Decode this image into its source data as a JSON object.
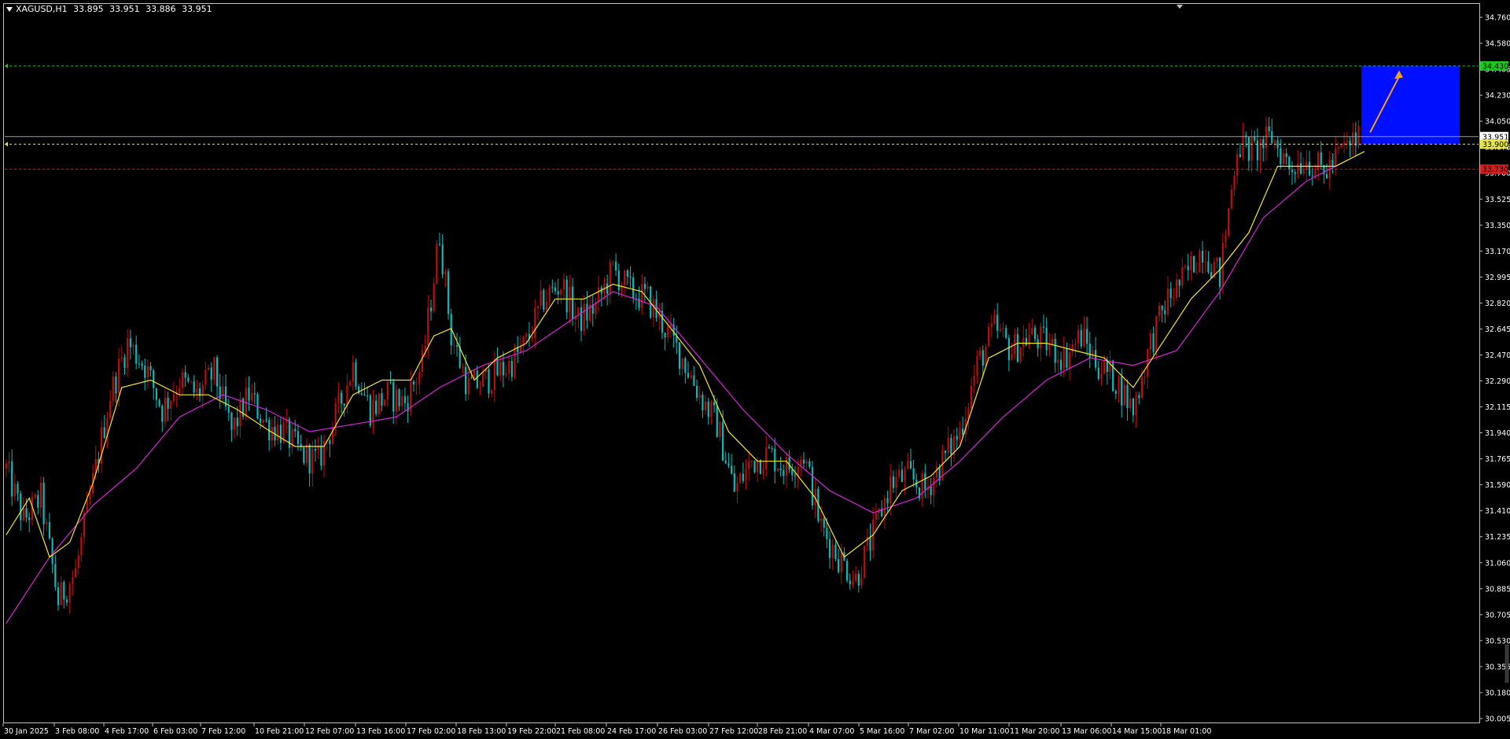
{
  "header": {
    "symbol": "XAGUSD,H1",
    "open": "33.895",
    "high": "33.951",
    "low": "33.886",
    "close": "33.951"
  },
  "colors": {
    "background": "#000000",
    "frame": "#C0C0C0",
    "bull_candle": "#B80F0F",
    "bear_candle": "#0FB8B8",
    "ma_fast": "#F2E626",
    "ma_slow": "#D626D6",
    "target_line": "#1EC81E",
    "entry_line": "#E6E646",
    "stop_line": "#D21E1E",
    "target_box": "#0010FF",
    "arrow": "#F0A020",
    "axis_text": "#FFFFFF"
  },
  "chart_data": {
    "type": "candlestick",
    "x_tick_labels": [
      "30 Jan 2025",
      "3 Feb 08:00",
      "4 Feb 17:00",
      "6 Feb 03:00",
      "7 Feb 12:00",
      "10 Feb 21:00",
      "12 Feb 07:00",
      "13 Feb 16:00",
      "17 Feb 02:00",
      "18 Feb 13:00",
      "19 Feb 22:00",
      "21 Feb 08:00",
      "24 Feb 17:00",
      "26 Feb 03:00",
      "27 Feb 12:00",
      "28 Feb 21:00",
      "4 Mar 07:00",
      "5 Mar 16:00",
      "7 Mar 02:00",
      "10 Mar 11:00",
      "11 Mar 20:00",
      "13 Mar 06:00",
      "14 Mar 15:00",
      "18 Mar 01:00"
    ],
    "y_tick_labels": [
      "34.760",
      "34.580",
      "34.405",
      "34.230",
      "34.050",
      "33.875",
      "33.700",
      "33.525",
      "33.350",
      "33.170",
      "32.995",
      "32.820",
      "32.645",
      "32.470",
      "32.290",
      "32.115",
      "31.940",
      "31.765",
      "31.590",
      "31.410",
      "31.235",
      "31.060",
      "30.885",
      "30.705",
      "30.530",
      "30.355",
      "30.180",
      "30.005"
    ],
    "y_range": [
      30.005,
      34.76
    ],
    "close_path": [
      [
        0,
        31.7
      ],
      [
        6,
        31.35
      ],
      [
        12,
        31.5
      ],
      [
        18,
        30.8
      ],
      [
        24,
        31.0
      ],
      [
        30,
        31.6
      ],
      [
        36,
        32.2
      ],
      [
        42,
        32.55
      ],
      [
        48,
        32.4
      ],
      [
        54,
        32.1
      ],
      [
        60,
        32.3
      ],
      [
        66,
        32.2
      ],
      [
        72,
        32.35
      ],
      [
        78,
        31.95
      ],
      [
        84,
        32.2
      ],
      [
        90,
        32.0
      ],
      [
        96,
        31.95
      ],
      [
        102,
        31.8
      ],
      [
        108,
        31.75
      ],
      [
        114,
        32.05
      ],
      [
        120,
        32.4
      ],
      [
        126,
        32.1
      ],
      [
        132,
        32.2
      ],
      [
        138,
        32.15
      ],
      [
        144,
        32.4
      ],
      [
        150,
        33.3
      ],
      [
        154,
        32.6
      ],
      [
        160,
        32.25
      ],
      [
        166,
        32.3
      ],
      [
        174,
        32.4
      ],
      [
        180,
        32.55
      ],
      [
        186,
        32.85
      ],
      [
        192,
        32.95
      ],
      [
        198,
        32.7
      ],
      [
        204,
        32.8
      ],
      [
        210,
        33.05
      ],
      [
        216,
        32.9
      ],
      [
        222,
        32.85
      ],
      [
        228,
        32.65
      ],
      [
        234,
        32.45
      ],
      [
        240,
        32.2
      ],
      [
        246,
        32.0
      ],
      [
        252,
        31.55
      ],
      [
        258,
        31.75
      ],
      [
        264,
        31.8
      ],
      [
        270,
        31.7
      ],
      [
        276,
        31.8
      ],
      [
        282,
        31.3
      ],
      [
        288,
        31.1
      ],
      [
        294,
        30.95
      ],
      [
        300,
        31.25
      ],
      [
        306,
        31.6
      ],
      [
        312,
        31.65
      ],
      [
        318,
        31.55
      ],
      [
        324,
        31.75
      ],
      [
        330,
        31.95
      ],
      [
        336,
        32.4
      ],
      [
        342,
        32.65
      ],
      [
        348,
        32.5
      ],
      [
        354,
        32.6
      ],
      [
        360,
        32.55
      ],
      [
        366,
        32.45
      ],
      [
        372,
        32.6
      ],
      [
        378,
        32.4
      ],
      [
        384,
        32.3
      ],
      [
        390,
        32.1
      ],
      [
        396,
        32.55
      ],
      [
        402,
        32.85
      ],
      [
        408,
        33.0
      ],
      [
        414,
        33.2
      ],
      [
        420,
        33.0
      ],
      [
        426,
        33.9
      ],
      [
        432,
        33.85
      ],
      [
        438,
        33.95
      ],
      [
        444,
        33.75
      ],
      [
        450,
        33.8
      ],
      [
        456,
        33.7
      ],
      [
        462,
        33.85
      ],
      [
        468,
        33.951
      ]
    ],
    "series": [
      {
        "name": "",
        "kind": "moving-average-fast",
        "points": [
          [
            0,
            31.25
          ],
          [
            8,
            31.5
          ],
          [
            15,
            31.1
          ],
          [
            22,
            31.2
          ],
          [
            30,
            31.6
          ],
          [
            40,
            32.25
          ],
          [
            50,
            32.3
          ],
          [
            60,
            32.2
          ],
          [
            70,
            32.2
          ],
          [
            80,
            32.1
          ],
          [
            90,
            31.97
          ],
          [
            100,
            31.85
          ],
          [
            110,
            31.85
          ],
          [
            120,
            32.2
          ],
          [
            130,
            32.3
          ],
          [
            140,
            32.3
          ],
          [
            148,
            32.6
          ],
          [
            154,
            32.65
          ],
          [
            162,
            32.3
          ],
          [
            170,
            32.45
          ],
          [
            180,
            32.55
          ],
          [
            190,
            32.85
          ],
          [
            200,
            32.85
          ],
          [
            210,
            32.95
          ],
          [
            220,
            32.9
          ],
          [
            230,
            32.65
          ],
          [
            240,
            32.4
          ],
          [
            250,
            31.95
          ],
          [
            260,
            31.75
          ],
          [
            270,
            31.75
          ],
          [
            280,
            31.5
          ],
          [
            290,
            31.1
          ],
          [
            300,
            31.25
          ],
          [
            310,
            31.55
          ],
          [
            320,
            31.65
          ],
          [
            330,
            31.85
          ],
          [
            340,
            32.45
          ],
          [
            350,
            32.55
          ],
          [
            360,
            32.55
          ],
          [
            370,
            32.5
          ],
          [
            380,
            32.45
          ],
          [
            390,
            32.25
          ],
          [
            400,
            32.55
          ],
          [
            410,
            32.85
          ],
          [
            420,
            33.05
          ],
          [
            430,
            33.3
          ],
          [
            440,
            33.75
          ],
          [
            450,
            33.75
          ],
          [
            460,
            33.75
          ],
          [
            470,
            33.85
          ]
        ]
      },
      {
        "name": "",
        "kind": "moving-average-slow",
        "points": [
          [
            0,
            30.65
          ],
          [
            15,
            31.1
          ],
          [
            30,
            31.45
          ],
          [
            45,
            31.7
          ],
          [
            60,
            32.05
          ],
          [
            75,
            32.2
          ],
          [
            90,
            32.1
          ],
          [
            105,
            31.95
          ],
          [
            120,
            32.0
          ],
          [
            135,
            32.05
          ],
          [
            150,
            32.25
          ],
          [
            165,
            32.4
          ],
          [
            180,
            32.5
          ],
          [
            195,
            32.7
          ],
          [
            210,
            32.9
          ],
          [
            225,
            32.8
          ],
          [
            240,
            32.45
          ],
          [
            255,
            32.1
          ],
          [
            270,
            31.8
          ],
          [
            285,
            31.55
          ],
          [
            300,
            31.4
          ],
          [
            315,
            31.5
          ],
          [
            330,
            31.75
          ],
          [
            345,
            32.05
          ],
          [
            360,
            32.3
          ],
          [
            375,
            32.45
          ],
          [
            390,
            32.4
          ],
          [
            405,
            32.5
          ],
          [
            420,
            32.9
          ],
          [
            435,
            33.4
          ],
          [
            450,
            33.65
          ],
          [
            465,
            33.8
          ]
        ]
      }
    ],
    "levels": {
      "target": {
        "value": 34.43,
        "label": "34.430"
      },
      "current": {
        "value": 33.951,
        "label": "33.951"
      },
      "entry": {
        "value": 33.9,
        "label": "33.900"
      },
      "stop": {
        "value": 33.73,
        "label": "33.730"
      }
    },
    "target_box": {
      "bar_start": 469,
      "bar_end": 503,
      "price_low": 33.9,
      "price_high": 34.43
    },
    "arrow": {
      "from": [
        472,
        33.98
      ],
      "to": [
        482,
        34.4
      ]
    },
    "total_bars": 510,
    "grid": false,
    "legend": "none"
  }
}
